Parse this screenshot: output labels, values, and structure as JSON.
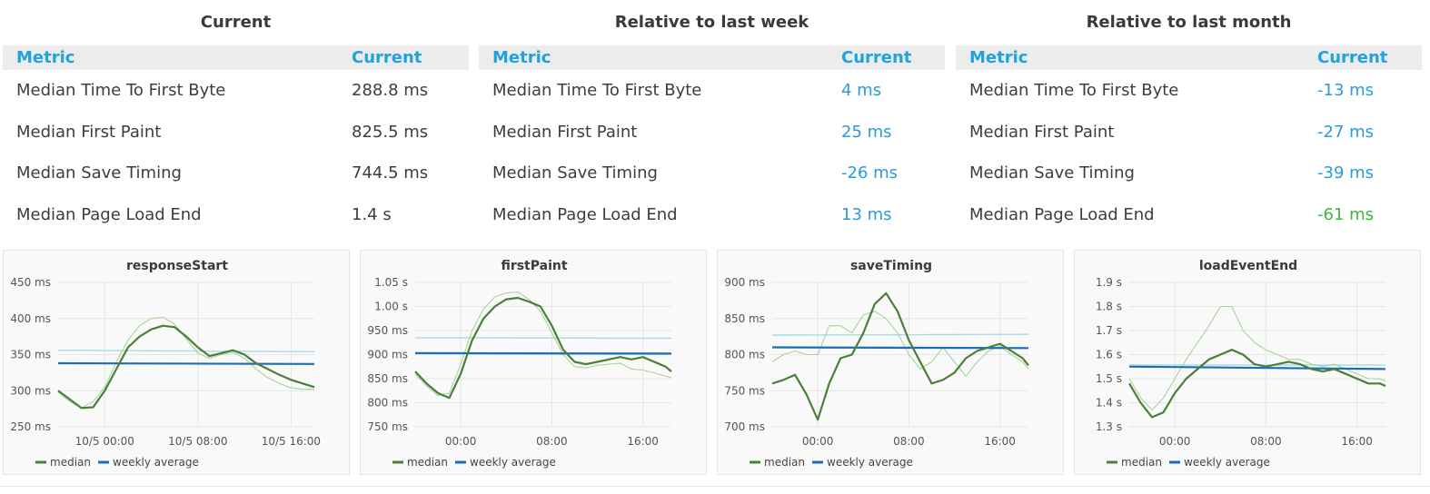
{
  "tables": [
    {
      "title": "Current",
      "header": {
        "metric": "Metric",
        "value": "Current"
      },
      "rows": [
        {
          "metric": "Median Time To First Byte",
          "value": "288.8 ms"
        },
        {
          "metric": "Median First Paint",
          "value": "825.5 ms"
        },
        {
          "metric": "Median Save Timing",
          "value": "744.5 ms"
        },
        {
          "metric": "Median Page Load End",
          "value": "1.4 s"
        }
      ]
    },
    {
      "title": "Relative to last week",
      "header": {
        "metric": "Metric",
        "value": "Current"
      },
      "rows": [
        {
          "metric": "Median Time To First Byte",
          "value": "4 ms"
        },
        {
          "metric": "Median First Paint",
          "value": "25 ms"
        },
        {
          "metric": "Median Save Timing",
          "value": "-26 ms"
        },
        {
          "metric": "Median Page Load End",
          "value": "13 ms"
        }
      ]
    },
    {
      "title": "Relative to last month",
      "header": {
        "metric": "Metric",
        "value": "Current"
      },
      "rows": [
        {
          "metric": "Median Time To First Byte",
          "value": "-13 ms"
        },
        {
          "metric": "Median First Paint",
          "value": "-27 ms"
        },
        {
          "metric": "Median Save Timing",
          "value": "-39 ms"
        },
        {
          "metric": "Median Page Load End",
          "value": "-61 ms"
        }
      ]
    }
  ],
  "colors": {
    "header_text": "#1fa2e0",
    "value_blue": "#2a9bd8",
    "value_green": "#3bb83b",
    "median": "#4a7f3a",
    "median_light": "#a8d49a",
    "weekly_average": "#1a6db8",
    "weekly_average_light": "#a6dbe8"
  },
  "chart_data": [
    {
      "type": "line",
      "title": "responseStart",
      "unit": "ms",
      "ylim": [
        250,
        450
      ],
      "yticks": [
        250,
        300,
        350,
        400,
        450
      ],
      "ytick_labels": [
        "250 ms",
        "300 ms",
        "350 ms",
        "400 ms",
        "450 ms"
      ],
      "xlim": [
        -4,
        18
      ],
      "xticks": [
        0,
        8,
        16
      ],
      "xtick_labels": [
        "10/5 00:00",
        "10/5 08:00",
        "10/5 16:00"
      ],
      "grid": true,
      "legend": "bottom-left",
      "legend_entries": [
        "median",
        "weekly average"
      ],
      "series": [
        {
          "name": "median",
          "x": [
            -4,
            -3,
            -2,
            -1,
            0,
            1,
            2,
            3,
            4,
            5,
            6,
            7,
            8,
            9,
            10,
            11,
            12,
            13,
            14,
            15,
            16,
            17,
            18
          ],
          "y": [
            300,
            288,
            276,
            277,
            300,
            330,
            360,
            375,
            385,
            390,
            388,
            375,
            360,
            348,
            352,
            356,
            350,
            338,
            330,
            322,
            315,
            310,
            305
          ]
        },
        {
          "name": "",
          "x": [
            -4,
            -3,
            -2,
            -1,
            0,
            1,
            2,
            3,
            4,
            5,
            6,
            7,
            8,
            9,
            10,
            11,
            12,
            13,
            14,
            15,
            16,
            17,
            18
          ],
          "y": [
            298,
            285,
            276,
            285,
            305,
            340,
            370,
            390,
            400,
            402,
            392,
            372,
            352,
            345,
            350,
            353,
            345,
            330,
            318,
            310,
            304,
            302,
            302
          ]
        },
        {
          "name": "weekly average",
          "x": [
            -4,
            18
          ],
          "y": [
            338,
            337
          ]
        },
        {
          "name": "",
          "x": [
            -4,
            18
          ],
          "y": [
            356,
            354
          ]
        }
      ]
    },
    {
      "type": "line",
      "title": "firstPaint",
      "unit": "s",
      "ylim": [
        750,
        1050
      ],
      "yticks": [
        750,
        800,
        850,
        900,
        950,
        1000,
        1050
      ],
      "ytick_labels": [
        "750 ms",
        "800 ms",
        "850 ms",
        "900 ms",
        "950 ms",
        "1.00 s",
        "1.05 s"
      ],
      "xlim": [
        -4,
        18.5
      ],
      "xticks": [
        0,
        8,
        16
      ],
      "xtick_labels": [
        "00:00",
        "08:00",
        "16:00"
      ],
      "grid": true,
      "legend": "bottom-left",
      "legend_entries": [
        "median",
        "weekly average"
      ],
      "series": [
        {
          "name": "median",
          "x": [
            -4,
            -3,
            -2,
            -1,
            0,
            1,
            2,
            3,
            4,
            5,
            6,
            7,
            8,
            9,
            10,
            11,
            12,
            13,
            14,
            15,
            16,
            17,
            18,
            18.5
          ],
          "y": [
            865,
            840,
            820,
            810,
            860,
            930,
            975,
            1000,
            1015,
            1018,
            1010,
            1000,
            960,
            910,
            885,
            880,
            885,
            890,
            895,
            890,
            895,
            885,
            875,
            865
          ]
        },
        {
          "name": "",
          "x": [
            -4,
            -3,
            -2,
            -1,
            0,
            1,
            2,
            3,
            4,
            5,
            6,
            7,
            8,
            9,
            10,
            11,
            12,
            13,
            14,
            15,
            16,
            17,
            18,
            18.5
          ],
          "y": [
            860,
            835,
            815,
            820,
            880,
            950,
            995,
            1020,
            1028,
            1030,
            1015,
            990,
            945,
            900,
            875,
            872,
            878,
            880,
            882,
            870,
            868,
            862,
            855,
            852
          ]
        },
        {
          "name": "weekly average",
          "x": [
            -4,
            18.5
          ],
          "y": [
            903,
            902
          ]
        },
        {
          "name": "",
          "x": [
            -4,
            18.5
          ],
          "y": [
            935,
            934
          ]
        }
      ]
    },
    {
      "type": "line",
      "title": "saveTiming",
      "unit": "ms",
      "ylim": [
        700,
        900
      ],
      "yticks": [
        700,
        750,
        800,
        850,
        900
      ],
      "ytick_labels": [
        "700 ms",
        "750 ms",
        "800 ms",
        "850 ms",
        "900 ms"
      ],
      "xlim": [
        -4,
        18.5
      ],
      "xticks": [
        0,
        8,
        16
      ],
      "xtick_labels": [
        "00:00",
        "08:00",
        "16:00"
      ],
      "grid": true,
      "legend": "bottom-left",
      "legend_entries": [
        "median",
        "weekly average"
      ],
      "series": [
        {
          "name": "median",
          "x": [
            -4,
            -3,
            -2,
            -1,
            0,
            1,
            2,
            3,
            4,
            5,
            6,
            7,
            8,
            9,
            10,
            11,
            12,
            13,
            14,
            15,
            16,
            17,
            18,
            18.5
          ],
          "y": [
            760,
            765,
            772,
            745,
            710,
            760,
            795,
            800,
            830,
            870,
            885,
            860,
            820,
            790,
            760,
            765,
            775,
            795,
            805,
            810,
            815,
            805,
            795,
            785
          ]
        },
        {
          "name": "",
          "x": [
            -4,
            -3,
            -2,
            -1,
            0,
            1,
            2,
            3,
            4,
            5,
            6,
            7,
            8,
            9,
            10,
            11,
            12,
            13,
            14,
            15,
            16,
            17,
            18,
            18.5
          ],
          "y": [
            790,
            800,
            805,
            800,
            800,
            840,
            840,
            830,
            855,
            860,
            850,
            830,
            800,
            780,
            790,
            810,
            790,
            770,
            790,
            805,
            812,
            800,
            790,
            780
          ]
        },
        {
          "name": "weekly average",
          "x": [
            -4,
            18.5
          ],
          "y": [
            810,
            809
          ]
        },
        {
          "name": "",
          "x": [
            -4,
            18.5
          ],
          "y": [
            827,
            828
          ]
        }
      ]
    },
    {
      "type": "line",
      "title": "loadEventEnd",
      "unit": "s",
      "ylim": [
        1.3,
        1.9
      ],
      "yticks": [
        1.3,
        1.4,
        1.5,
        1.6,
        1.7,
        1.8,
        1.9
      ],
      "ytick_labels": [
        "1.3 s",
        "1.4 s",
        "1.5 s",
        "1.6 s",
        "1.7 s",
        "1.8 s",
        "1.9 s"
      ],
      "xlim": [
        -4,
        18.5
      ],
      "xticks": [
        0,
        8,
        16
      ],
      "xtick_labels": [
        "00:00",
        "08:00",
        "16:00"
      ],
      "grid": true,
      "legend": "bottom-left",
      "legend_entries": [
        "median",
        "weekly average"
      ],
      "series": [
        {
          "name": "median",
          "x": [
            -4,
            -3,
            -2,
            -1,
            0,
            1,
            2,
            3,
            4,
            5,
            6,
            7,
            8,
            9,
            10,
            11,
            12,
            13,
            14,
            15,
            16,
            17,
            18,
            18.5
          ],
          "y": [
            1.48,
            1.4,
            1.34,
            1.36,
            1.44,
            1.5,
            1.54,
            1.58,
            1.6,
            1.62,
            1.6,
            1.56,
            1.55,
            1.56,
            1.57,
            1.56,
            1.54,
            1.53,
            1.54,
            1.52,
            1.5,
            1.48,
            1.48,
            1.47
          ]
        },
        {
          "name": "",
          "x": [
            -4,
            -3,
            -2,
            -1,
            0,
            1,
            2,
            3,
            4,
            5,
            6,
            7,
            8,
            9,
            10,
            11,
            12,
            13,
            14,
            15,
            16,
            17,
            18,
            18.5
          ],
          "y": [
            1.5,
            1.42,
            1.37,
            1.42,
            1.5,
            1.58,
            1.65,
            1.72,
            1.8,
            1.8,
            1.7,
            1.65,
            1.62,
            1.6,
            1.58,
            1.58,
            1.56,
            1.55,
            1.56,
            1.54,
            1.52,
            1.5,
            1.5,
            1.49
          ]
        },
        {
          "name": "weekly average",
          "x": [
            -4,
            18.5
          ],
          "y": [
            1.55,
            1.54
          ]
        },
        {
          "name": "",
          "x": [
            -4,
            18.5
          ],
          "y": [
            1.557,
            1.557
          ]
        }
      ]
    }
  ]
}
